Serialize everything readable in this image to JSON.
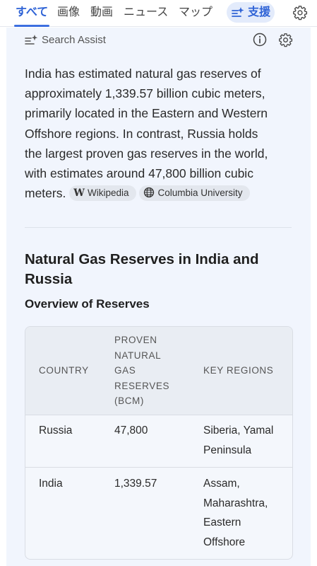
{
  "nav": {
    "tabs": [
      {
        "label": "すべて",
        "active": true
      },
      {
        "label": "画像"
      },
      {
        "label": "動画"
      },
      {
        "label": "ニュース"
      },
      {
        "label": "マップ"
      }
    ],
    "assist_tab": {
      "label": "支援",
      "icon": "sparkle-list-icon"
    },
    "settings_icon": "gear-icon"
  },
  "search_assist": {
    "header_label": "Search Assist",
    "answer_lines": [
      "India has estimated natural gas reserves of",
      "approximately 1,339.57 billion cubic meters,",
      "primarily located in the Eastern and Western",
      "Offshore regions. In contrast, Russia holds",
      "the largest proven gas reserves in the world,",
      "with estimates around 47,800 billion cubic",
      "meters."
    ],
    "sources": [
      {
        "label": "Wikipedia",
        "icon": "wikipedia-icon"
      },
      {
        "label": "Columbia University",
        "icon": "globe-icon"
      }
    ],
    "section_title": "Natural Gas Reserves in India and Russia",
    "subsection_title": "Overview of Reserves",
    "table": {
      "headers": [
        "COUNTRY",
        "PROVEN NATURAL GAS RESERVES (BCM)",
        "KEY REGIONS"
      ],
      "header_lines": [
        "PROVEN",
        "NATURAL",
        "GAS",
        "RESERVES",
        "(BCM)"
      ],
      "rows": [
        {
          "country": "Russia",
          "reserves": "47,800",
          "regions": [
            "Siberia, Yamal",
            "Peninsula"
          ]
        },
        {
          "country": "India",
          "reserves": "1,339.57",
          "regions": [
            "Assam,",
            "Maharashtra,",
            "Eastern",
            "Offshore"
          ]
        }
      ]
    }
  },
  "colors": {
    "accent": "#2f63d6",
    "panel_bg": "#f1f5fd",
    "chip_bg": "#e3e7ee"
  }
}
